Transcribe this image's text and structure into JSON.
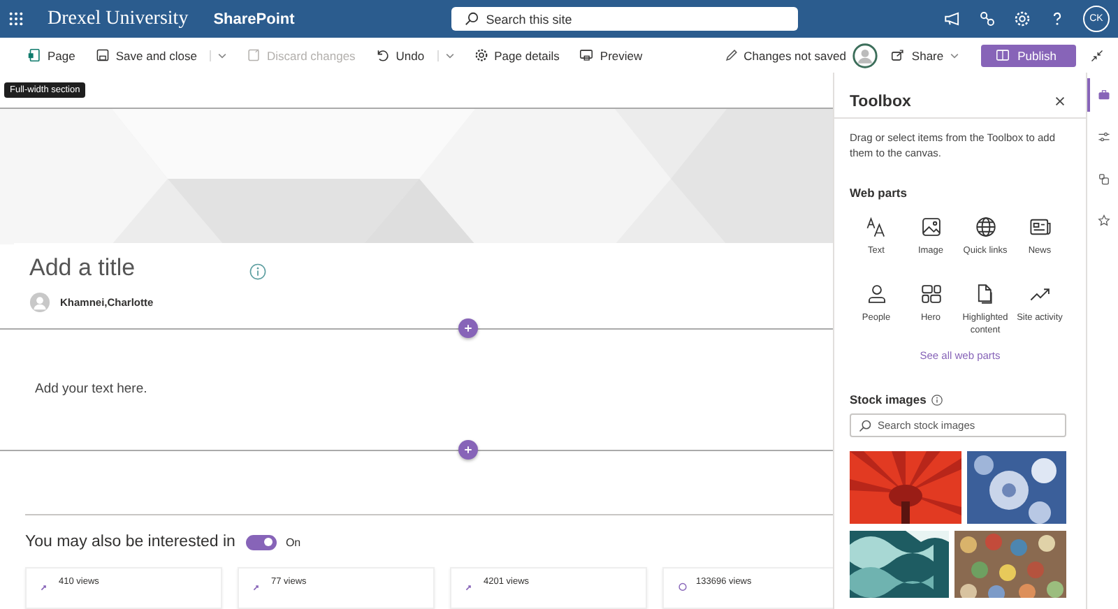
{
  "top_bar": {
    "logo": "Drexel University",
    "app": "SharePoint",
    "search": {
      "placeholder": "Search this site"
    },
    "user_initials": "CK"
  },
  "command_bar": {
    "items": [
      {
        "label": "Page",
        "disabled": false,
        "split": false
      },
      {
        "label": "Save and close",
        "disabled": false,
        "split": true
      },
      {
        "label": "Discard changes",
        "disabled": true,
        "split": false
      },
      {
        "label": "Undo",
        "disabled": false,
        "split": true
      },
      {
        "label": "Page details",
        "disabled": false,
        "split": false
      },
      {
        "label": "Preview",
        "disabled": false,
        "split": false
      }
    ],
    "status": "Changes not saved",
    "share": "Share",
    "publish": "Publish"
  },
  "canvas": {
    "tooltip": "Full-width section",
    "title": {
      "placeholder": "Add a title"
    },
    "author": "Khamnei,Charlotte",
    "text": {
      "placeholder": "Add your text here."
    },
    "related": {
      "heading": "You may also be interested in",
      "toggle": {
        "on": true,
        "label": "On"
      },
      "cards": [
        {
          "views": "410 views"
        },
        {
          "views": "77 views"
        },
        {
          "views": "4201 views"
        },
        {
          "views": "133696 views"
        }
      ]
    }
  },
  "toolbox": {
    "title": "Toolbox",
    "description": "Drag or select items from the Toolbox to add them to the canvas.",
    "web_parts_heading": "Web parts",
    "web_parts": [
      {
        "label": "Text"
      },
      {
        "label": "Image"
      },
      {
        "label": "Quick links"
      },
      {
        "label": "News"
      },
      {
        "label": "People"
      },
      {
        "label": "Hero"
      },
      {
        "label": "Highlighted content"
      },
      {
        "label": "Site activity"
      }
    ],
    "see_all": "See all web parts",
    "stock_heading": "Stock images",
    "stock_search": {
      "placeholder": "Search stock images"
    }
  },
  "rail_tabs": [
    {
      "selected": true
    },
    {
      "selected": false
    },
    {
      "selected": false
    },
    {
      "selected": false
    }
  ]
}
